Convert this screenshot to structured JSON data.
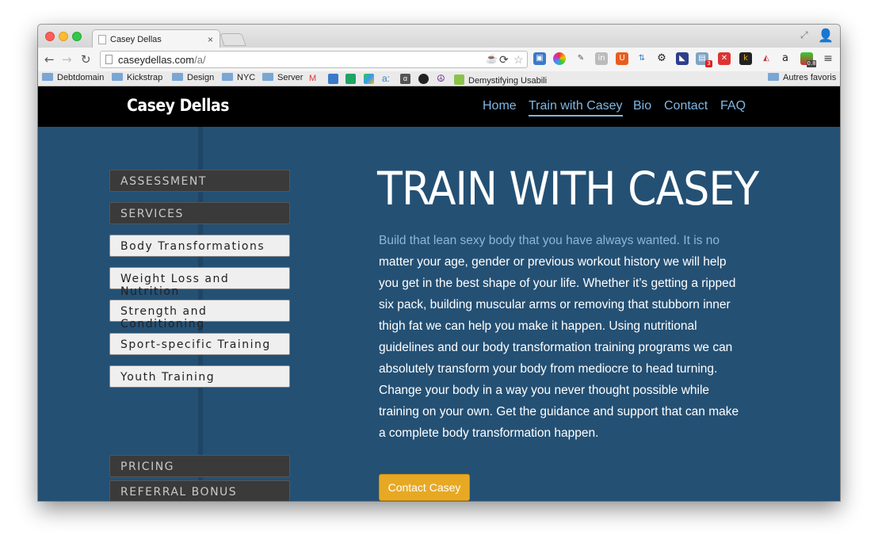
{
  "tab": {
    "title": "Casey Dellas"
  },
  "toolbar": {
    "url_host": "caseydellas.com",
    "url_path": "/a/"
  },
  "bookmarks": {
    "items": [
      "Debtdomain",
      "Kickstrap",
      "Design",
      "NYC",
      "Server",
      "Demystifying Usabili"
    ],
    "other": "Autres favoris"
  },
  "extensions": {
    "badge_count": "3",
    "version_badge": "0.8"
  },
  "site": {
    "brand": "Casey Dellas",
    "nav": [
      "Home",
      "Train with Casey",
      "Bio",
      "Contact",
      "FAQ"
    ],
    "sidebar": {
      "sections": [
        "ASSESSMENT",
        "SERVICES"
      ],
      "services": [
        "Body Transformations",
        "Weight Loss and Nutrition",
        "Strength and Conditioning",
        "Sport-specific Training",
        "Youth Training"
      ],
      "bottom_sections": [
        "PRICING",
        "REFERRAL BONUS"
      ]
    },
    "title": "TRAIN WITH CASEY",
    "intro_dim": "Build that lean sexy body that you have always wanted. It is no",
    "intro_rest": "matter your age, gender or previous workout history we will help you get in the best shape of your life. Whether it’s getting a ripped six pack, building muscular arms or removing that stubborn inner thigh fat we can help you make it happen. Using nutritional guidelines and our body transformation training programs we can absolutely transform your body from mediocre to head turning. Change your body in a way you never thought possible while training on your own. Get the guidance and support that can make a complete body transformation happen.",
    "cta": "Contact Casey"
  }
}
